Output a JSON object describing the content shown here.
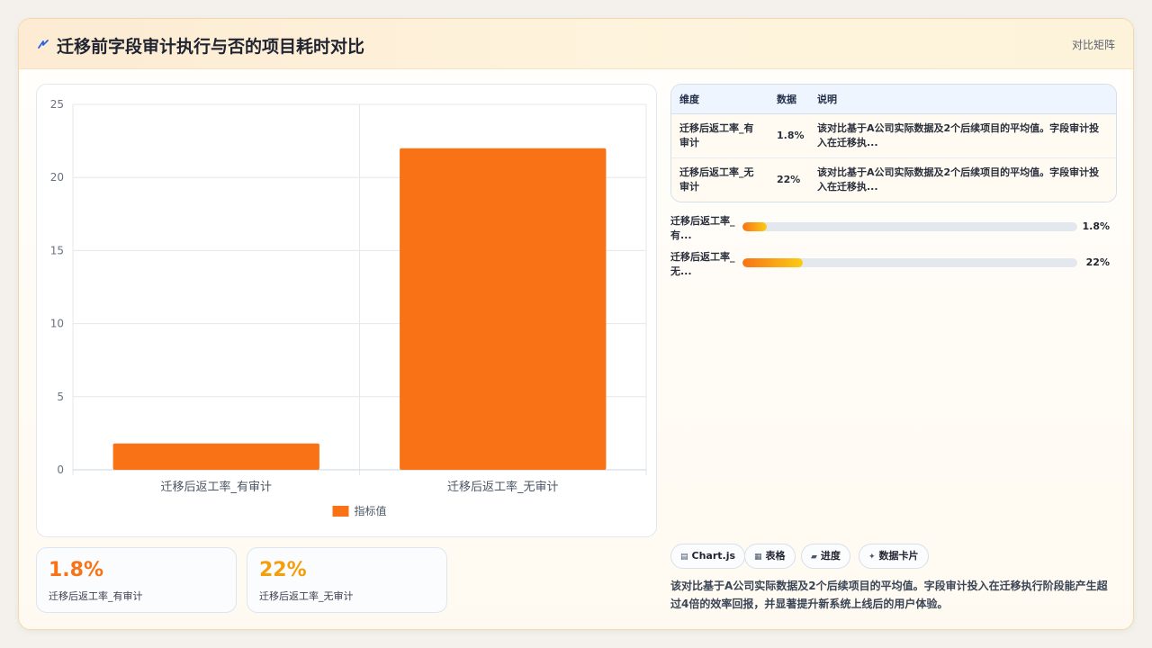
{
  "header": {
    "title": "迁移前字段审计执行与否的项目耗时对比",
    "mode_label": "对比矩阵",
    "icon": "lightning-icon"
  },
  "colors": {
    "bar": "#f97316",
    "kpi_primary": "#f97316",
    "kpi_secondary": "#f59e0b",
    "gradient_start": "#f97316",
    "gradient_end": "#facc15"
  },
  "chart_data": {
    "type": "bar",
    "categories": [
      "迁移后返工率_有审计",
      "迁移后返工率_无审计"
    ],
    "series": [
      {
        "name": "指标值",
        "values": [
          1.8,
          22
        ]
      }
    ],
    "ylim": [
      0,
      25
    ],
    "yticks": [
      0,
      5,
      10,
      15,
      20,
      25
    ],
    "xlabel": "",
    "ylabel": "",
    "grid": true,
    "legend": "bottom"
  },
  "kpis": [
    {
      "value": "1.8%",
      "label": "迁移后返工率_有审计"
    },
    {
      "value": "22%",
      "label": "迁移后返工率_无审计"
    }
  ],
  "table": {
    "headers": [
      "维度",
      "数据",
      "说明"
    ],
    "rows": [
      {
        "dimension": "迁移后返工率_有审计",
        "value": "1.8%",
        "note": "该对比基于A公司实际数据及2个后续项目的平均值。字段审计投入在迁移执..."
      },
      {
        "dimension": "迁移后返工率_无审计",
        "value": "22%",
        "note": "该对比基于A公司实际数据及2个后续项目的平均值。字段审计投入在迁移执..."
      }
    ]
  },
  "progress": [
    {
      "label": "迁移后返工率_有...",
      "value_text": "1.8%",
      "fraction": 0.072
    },
    {
      "label": "迁移后返工率_无...",
      "value_text": "22%",
      "fraction": 0.18
    }
  ],
  "chips": [
    {
      "label": "Chart.js",
      "icon": "chart-icon"
    },
    {
      "label": "表格",
      "icon": "table-icon"
    },
    {
      "label": "进度",
      "icon": "progress-icon"
    },
    {
      "label": "数据卡片",
      "icon": "sparkle-icon"
    }
  ],
  "summary": "该对比基于A公司实际数据及2个后续项目的平均值。字段审计投入在迁移执行阶段能产生超过4倍的效率回报，并显著提升新系统上线后的用户体验。"
}
